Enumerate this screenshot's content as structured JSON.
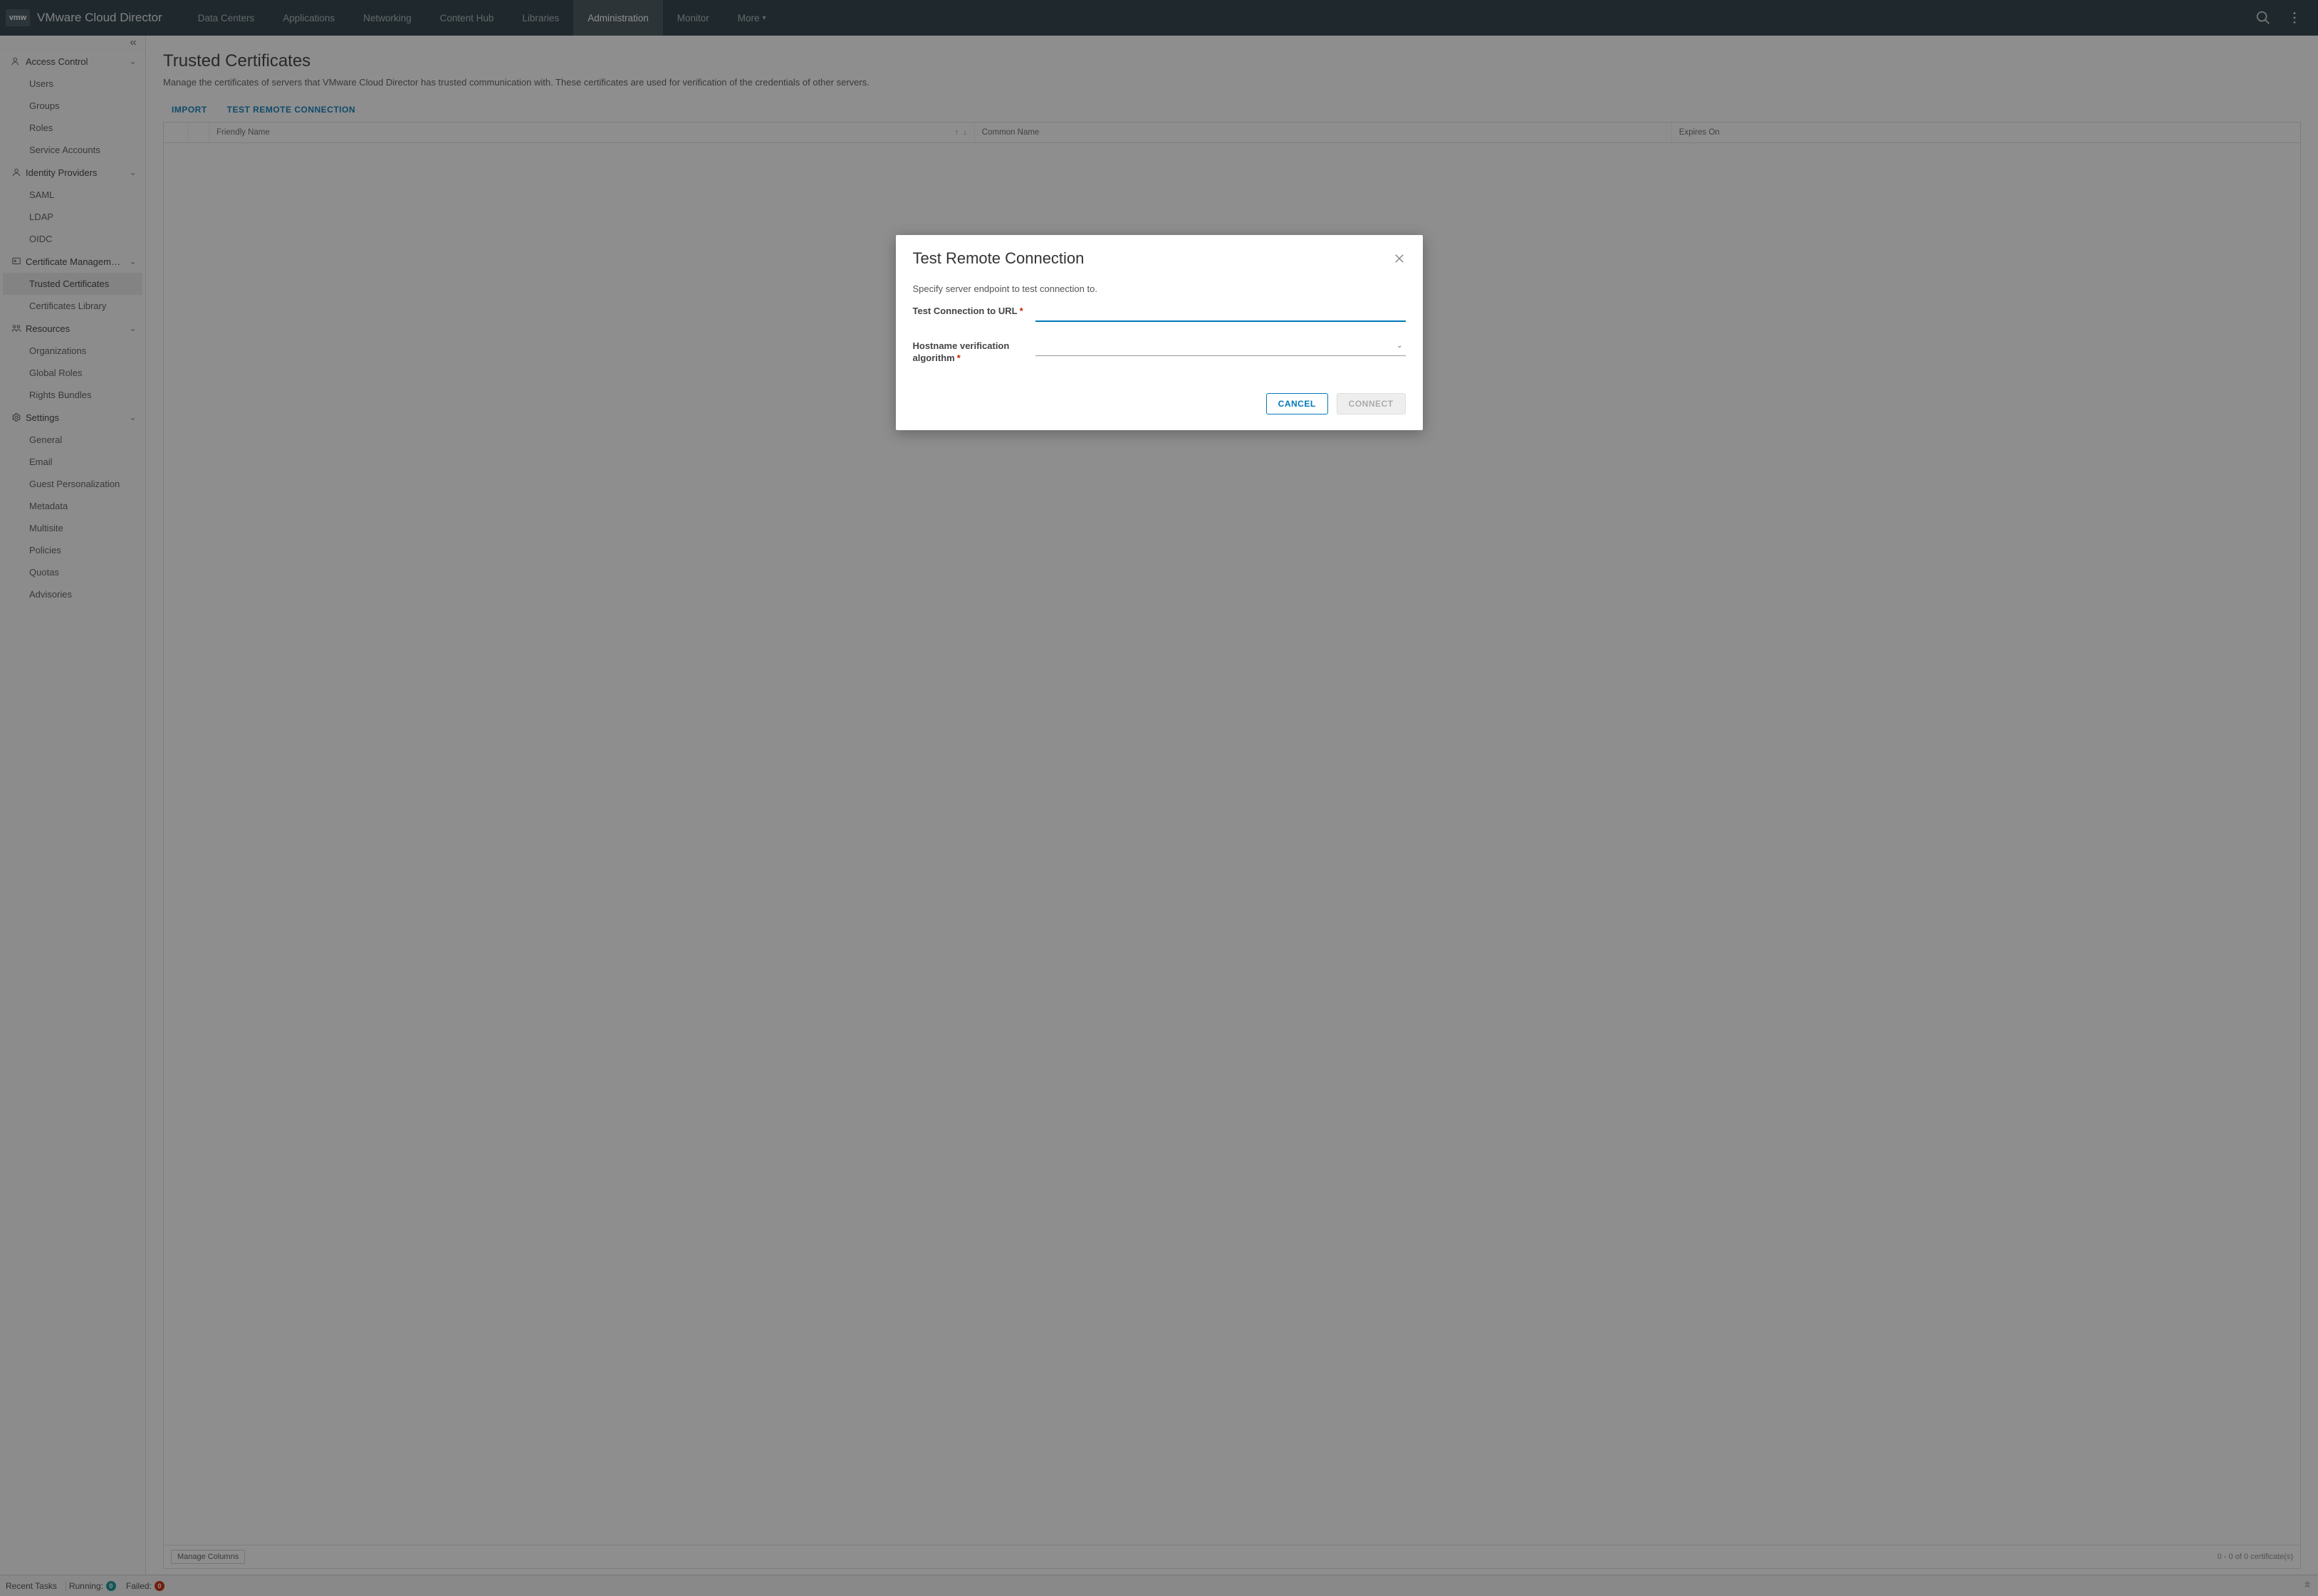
{
  "brand": {
    "logo_text": "vmw",
    "title": "VMware Cloud Director"
  },
  "nav": [
    {
      "label": "Data Centers",
      "active": false
    },
    {
      "label": "Applications",
      "active": false
    },
    {
      "label": "Networking",
      "active": false
    },
    {
      "label": "Content Hub",
      "active": false
    },
    {
      "label": "Libraries",
      "active": false
    },
    {
      "label": "Administration",
      "active": true
    },
    {
      "label": "Monitor",
      "active": false
    },
    {
      "label": "More",
      "active": false,
      "has_chevron": true
    }
  ],
  "sidebar": {
    "sections": [
      {
        "label": "Access Control",
        "items": [
          "Users",
          "Groups",
          "Roles",
          "Service Accounts"
        ]
      },
      {
        "label": "Identity Providers",
        "items": [
          "SAML",
          "LDAP",
          "OIDC"
        ]
      },
      {
        "label": "Certificate Managem…",
        "items": [
          "Trusted Certificates",
          "Certificates Library"
        ],
        "active_item": 0
      },
      {
        "label": "Resources",
        "items": [
          "Organizations",
          "Global Roles",
          "Rights Bundles"
        ]
      },
      {
        "label": "Settings",
        "items": [
          "General",
          "Email",
          "Guest Personalization",
          "Metadata",
          "Multisite",
          "Policies",
          "Quotas",
          "Advisories"
        ]
      }
    ]
  },
  "page": {
    "title": "Trusted Certificates",
    "description": "Manage the certificates of servers that VMware Cloud Director has trusted communication with. These certificates are used for verification of the credentials of other servers.",
    "actions": {
      "import": "IMPORT",
      "test_remote": "TEST REMOTE CONNECTION"
    },
    "columns": {
      "friendly": "Friendly Name",
      "common": "Common Name",
      "expires": "Expires On"
    },
    "manage_columns": "Manage Columns",
    "count_text": "0 - 0 of 0 certificate(s)"
  },
  "modal": {
    "title": "Test Remote Connection",
    "description": "Specify server endpoint to test connection to.",
    "url_label": "Test Connection to URL",
    "url_value": "",
    "algo_label": "Hostname verification algorithm",
    "algo_value": "",
    "cancel": "CANCEL",
    "connect": "CONNECT"
  },
  "footer": {
    "recent": "Recent Tasks",
    "running_label": "Running:",
    "running_count": "0",
    "failed_label": "Failed:",
    "failed_count": "0"
  }
}
